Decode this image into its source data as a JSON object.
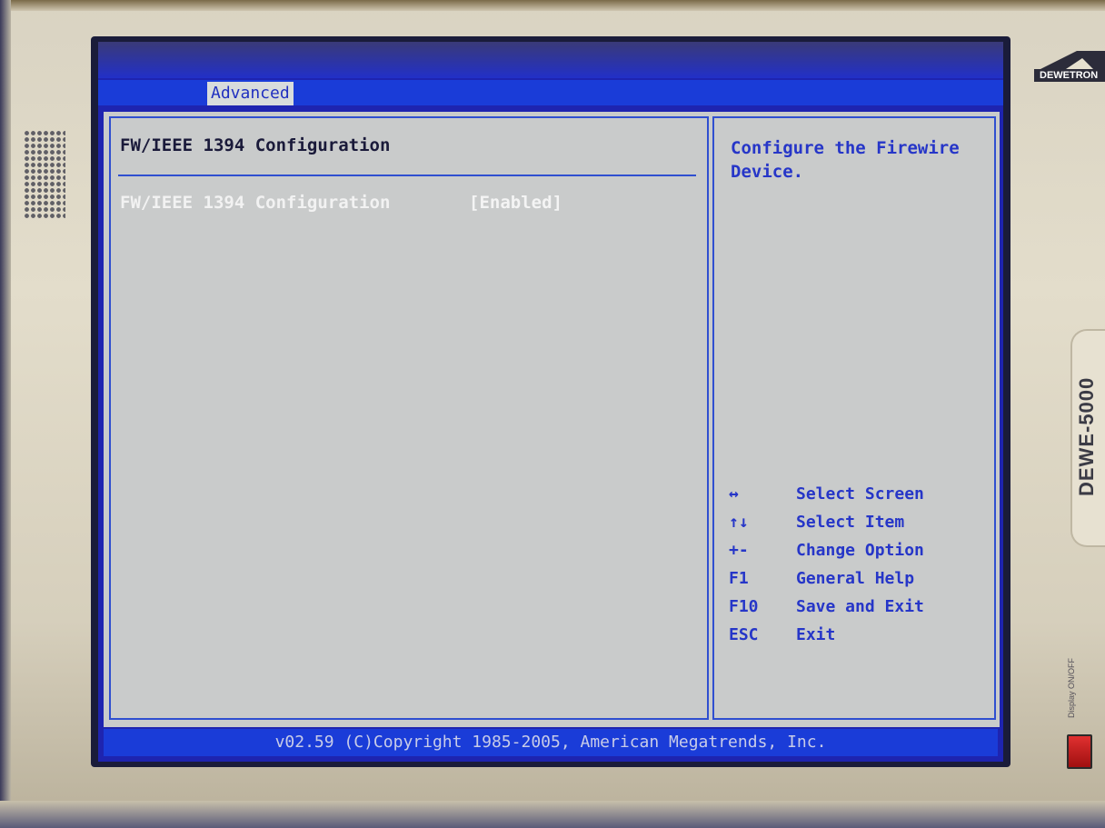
{
  "monitor": {
    "brand": "DEWETRON",
    "model": "DEWE-5000",
    "display_button_label": "Display ON/OFF"
  },
  "bios": {
    "active_tab": "Advanced",
    "section_title": "FW/IEEE 1394 Configuration",
    "settings": [
      {
        "label": "FW/IEEE 1394 Configuration",
        "value": "[Enabled]"
      }
    ],
    "help_text": "Configure the Firewire Device.",
    "key_legend": [
      {
        "key": "↔",
        "action": "Select Screen"
      },
      {
        "key": "↑↓",
        "action": "Select Item"
      },
      {
        "key": "+-",
        "action": "Change Option"
      },
      {
        "key": "F1",
        "action": "General Help"
      },
      {
        "key": "F10",
        "action": "Save and Exit"
      },
      {
        "key": "ESC",
        "action": "Exit"
      }
    ],
    "footer": "v02.59 (C)Copyright 1985-2005, American Megatrends, Inc."
  },
  "colors": {
    "bios_blue": "#1a3cd8",
    "panel_gray": "#c9cbcb",
    "highlight_text": "#2636c8"
  }
}
